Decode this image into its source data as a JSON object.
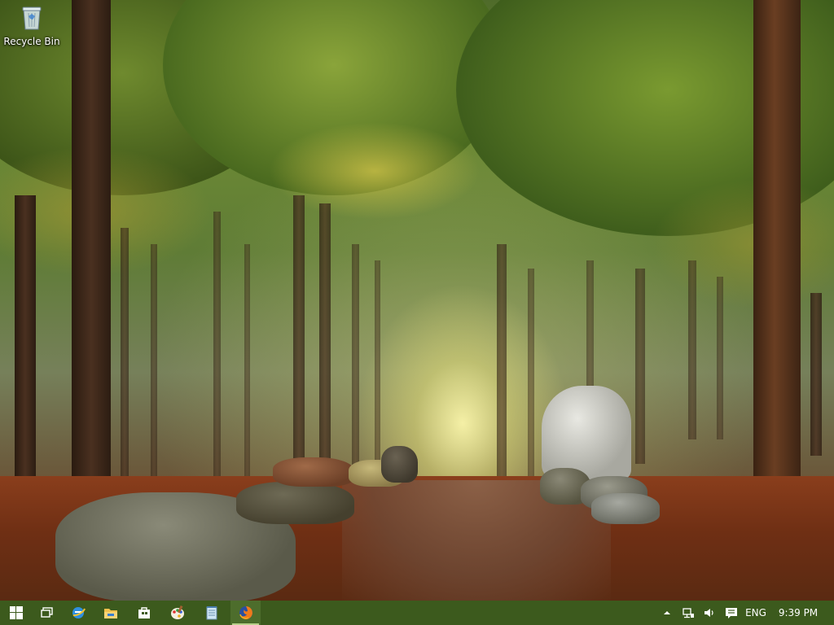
{
  "desktop": {
    "icons": [
      {
        "label": "Recycle Bin",
        "icon": "recycle-bin-icon"
      }
    ]
  },
  "taskbar": {
    "color": "#3c5a1d",
    "start_icon": "windows-logo-icon",
    "pinned": [
      {
        "icon": "task-view-icon"
      },
      {
        "icon": "internet-explorer-icon"
      },
      {
        "icon": "file-explorer-icon"
      },
      {
        "icon": "store-icon"
      },
      {
        "icon": "paint-icon"
      },
      {
        "icon": "notepad-icon"
      },
      {
        "icon": "firefox-icon",
        "active": true
      }
    ],
    "tray": {
      "overflow_icon": "chevron-up-icon",
      "network_icon": "network-icon",
      "volume_icon": "volume-icon",
      "notifications_icon": "action-center-icon",
      "language": "ENG",
      "time": "9:39 PM"
    }
  }
}
